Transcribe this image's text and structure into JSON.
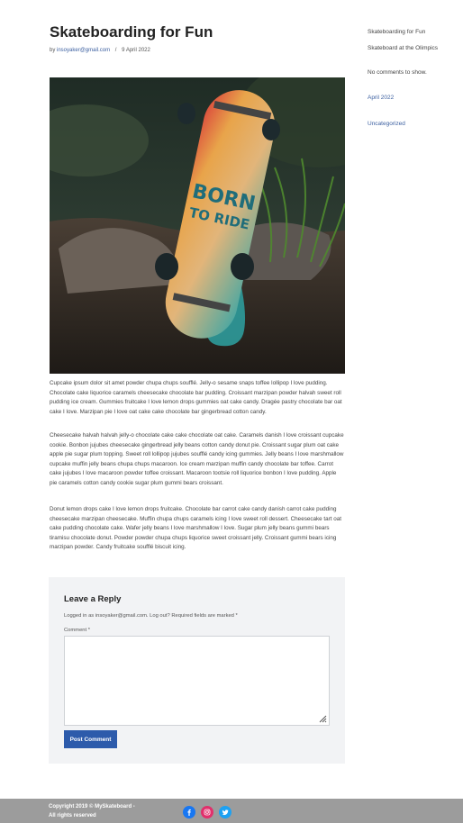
{
  "post": {
    "title": "Skateboarding for Fun",
    "by": "by",
    "author": "insoyaker@gmail.com",
    "separator": "/",
    "date": "9 April 2022",
    "image_board_text_1": "BORN",
    "image_board_text_2": "TO RIDE",
    "paragraphs": [
      "Cupcake ipsum dolor sit amet powder chupa chups soufflé. Jelly-o sesame snaps toffee lollipop I love pudding. Chocolate cake liquorice caramels cheesecake chocolate bar pudding. Croissant marzipan powder halvah sweet roll pudding ice cream. Gummies fruitcake I love lemon drops gummies oat cake candy. Dragée pastry chocolate bar oat cake I love. Marzipan pie I love oat cake cake chocolate bar gingerbread cotton candy.",
      "Cheesecake halvah halvah jelly-o chocolate cake cake chocolate oat cake. Caramels danish I love croissant cupcake cookie. Bonbon jujubes cheesecake gingerbread jelly beans cotton candy donut pie. Croissant sugar plum oat cake apple pie sugar plum topping. Sweet roll lollipop jujubes soufflé candy icing gummies. Jelly beans I love marshmallow cupcake muffin jelly beans chupa chups macaroon. Ice cream marzipan muffin candy chocolate bar toffee. Carrot cake jujubes I love macaroon powder toffee croissant. Macaroon tootsie roll liquorice bonbon I love pudding. Apple pie caramels cotton candy cookie sugar plum gummi bears croissant.",
      "Donut lemon drops cake I love lemon drops fruitcake. Chocolate bar carrot cake candy danish carrot cake pudding cheesecake marzipan cheesecake. Muffin chupa chups caramels icing I love sweet roll dessert. Cheesecake tart oat cake pudding chocolate cake. Wafer jelly beans I love marshmallow I love. Sugar plum jelly beans gummi bears tiramisu chocolate donut. Powder powder chupa chups liquorice sweet croissant jelly. Croissant gummi bears icing marzipan powder. Candy fruitcake soufflé biscuit icing."
    ]
  },
  "reply": {
    "title": "Leave a Reply",
    "logged_in": "Logged in as insoyaker@gmail.com. Log out? Required fields are marked *",
    "comment_label": "Comment *",
    "comment_value": "",
    "submit_label": "Post Comment"
  },
  "sidebar": {
    "recent_posts": [
      "Skateboarding for Fun",
      "Skateboard at the Olimpics"
    ],
    "comments_note": "No comments to show.",
    "archive": "April 2022",
    "category": "Uncategorized"
  },
  "footer": {
    "copyright_line1": "Copyright 2019 © MySkateboard -",
    "copyright_line2": "All rights reserved",
    "social_icons": [
      "facebook-icon",
      "instagram-icon",
      "twitter-icon"
    ],
    "colors": {
      "facebook": "#1877f2",
      "instagram": "#e1306c",
      "twitter": "#1da1f2",
      "footer_bg": "#9c9c9c",
      "button": "#2d5bab"
    }
  }
}
